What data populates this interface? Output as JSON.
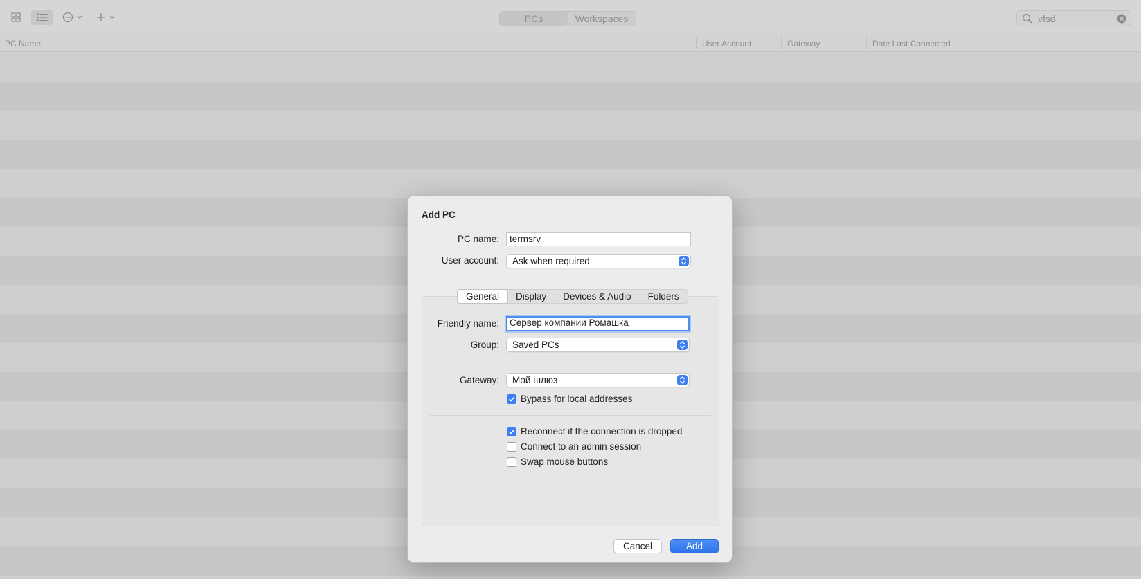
{
  "toolbar": {
    "segments": [
      "PCs",
      "Workspaces"
    ],
    "search_value": "vfsd"
  },
  "table": {
    "columns": [
      "PC Name",
      "User Account",
      "Gateway",
      "Date Last Connected"
    ]
  },
  "dialog": {
    "title": "Add PC",
    "pc_name_label": "PC name:",
    "pc_name_value": "termsrv",
    "user_account_label": "User account:",
    "user_account_value": "Ask when required",
    "tabs": [
      "General",
      "Display",
      "Devices & Audio",
      "Folders"
    ],
    "active_tab": "General",
    "friendly_name_label": "Friendly name:",
    "friendly_name_value": "Сервер компании Ромашка",
    "group_label": "Group:",
    "group_value": "Saved PCs",
    "gateway_label": "Gateway:",
    "gateway_value": "Мой шлюз",
    "bypass_label": "Bypass for local addresses",
    "bypass_checked": true,
    "reconnect_label": "Reconnect if the connection is dropped",
    "reconnect_checked": true,
    "admin_label": "Connect to an admin session",
    "admin_checked": false,
    "swap_label": "Swap mouse buttons",
    "swap_checked": false,
    "cancel_label": "Cancel",
    "add_label": "Add"
  },
  "colors": {
    "accent": "#3d7ff0",
    "dialog_bg": "#ececec",
    "backdrop": "#cfcfcf"
  }
}
